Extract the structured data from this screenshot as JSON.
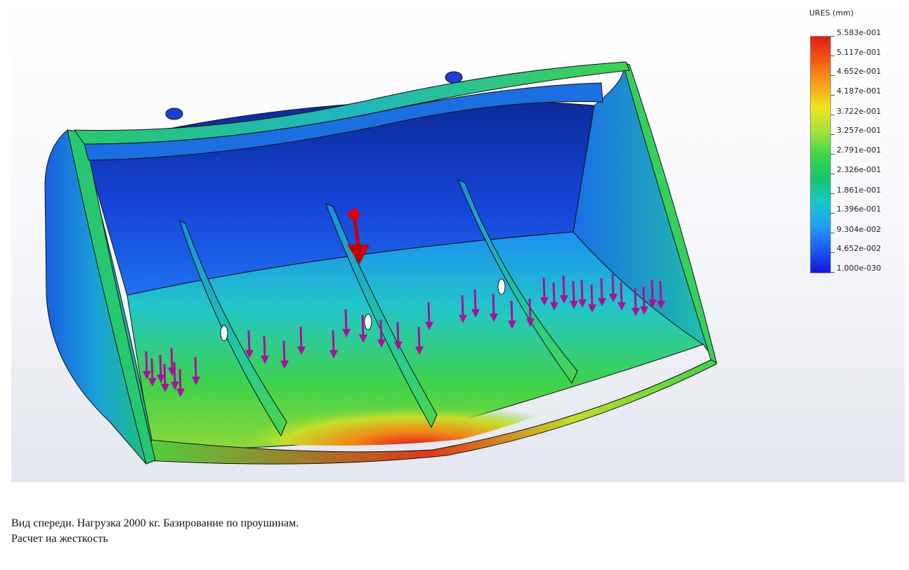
{
  "legend": {
    "title": "URES (mm)",
    "labels": [
      "5.583e-001",
      "5.117e-001",
      "4.652e-001",
      "4.187e-001",
      "3.722e-001",
      "3.257e-001",
      "2.791e-001",
      "2.326e-001",
      "1.861e-001",
      "1.396e-001",
      "9.304e-002",
      "4.652e-002",
      "1.000e-030"
    ],
    "colors": [
      "#e11b1b",
      "#f05a14",
      "#f6a01a",
      "#f1e21e",
      "#a6e13a",
      "#3fd64a",
      "#18c36b",
      "#16c9c8",
      "#22a0f2",
      "#1a5cf3",
      "#1515d8"
    ]
  },
  "caption": {
    "line1": "Вид спереди. Нагрузка 2000 кг. Базирование по проушинам.",
    "line2": "Расчет на жесткость"
  },
  "scene": {
    "model": "bucket",
    "load_arrow_color": "#a8129a",
    "reference_arrow_color": "#c40000",
    "background": "#f4f5f9"
  }
}
